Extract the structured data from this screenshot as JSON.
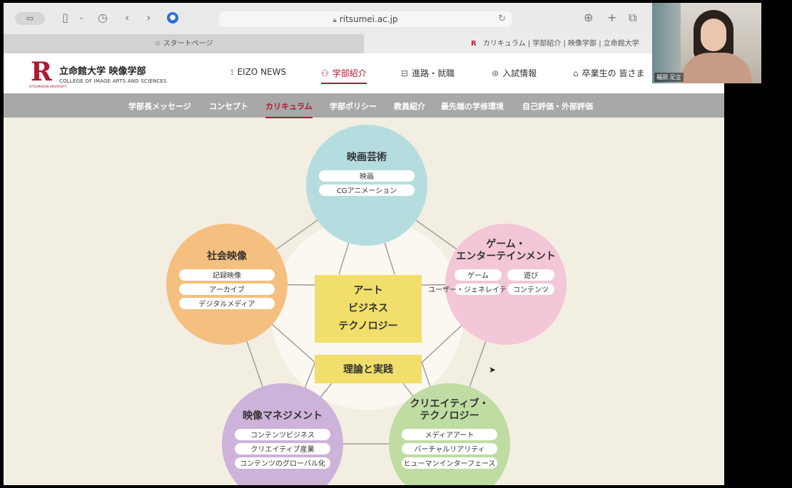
{
  "browser": {
    "sidebar_button": "▭",
    "address": "ritsumei.ac.jp",
    "tabs": [
      {
        "label": "スタートページ"
      },
      {
        "label": "カリキュラム | 学部紹介 | 映像学部 | 立命館大学"
      }
    ]
  },
  "site": {
    "logo_letter": "R",
    "logo_sub": "RITSUMEIKAN UNIVERSITY",
    "brand_ja": "立命館大学 映像学部",
    "brand_en": "COLLEGE OF IMAGE ARTS AND SCIENCES",
    "nav": [
      {
        "label": "EIZO NEWS",
        "icon": "megaphone-icon"
      },
      {
        "label": "学部紹介",
        "icon": "person-icon",
        "active": true
      },
      {
        "label": "進路・就職",
        "icon": "briefcase-icon"
      },
      {
        "label": "入試情報",
        "icon": "medal-icon"
      },
      {
        "label": "卒業生の 皆さま",
        "icon": "mortarboard-icon"
      }
    ],
    "subnav": [
      "学部長メッセージ",
      "コンセプト",
      "カリキュラム",
      "学部ポリシー",
      "教員紹介",
      "最先端の学修環境",
      "自己評価・外部評価"
    ],
    "subnav_active_index": 2
  },
  "diagram": {
    "center_lines": [
      "アート",
      "ビジネス",
      "テクノロジー"
    ],
    "center_sub": "理論と実践",
    "circles": [
      {
        "key": "art",
        "title": [
          "映画芸術"
        ],
        "color": "#b5dde0",
        "tags": [
          [
            "映画"
          ],
          [
            "CGアニメーション"
          ]
        ]
      },
      {
        "key": "game",
        "title": [
          "ゲーム・",
          "エンターテインメント"
        ],
        "color": "#f3c6d8",
        "tags": [
          [
            "ゲーム",
            "遊び"
          ],
          [
            "ユーザー・ジェネレイテッド・",
            "コンテンツ"
          ]
        ]
      },
      {
        "key": "tech",
        "title": [
          "クリエイティブ・",
          "テクノロジー"
        ],
        "color": "#bfdca2",
        "tags": [
          [
            "メディアアート"
          ],
          [
            "バーチャルリアリティ"
          ],
          [
            "ヒューマンインターフェース"
          ]
        ]
      },
      {
        "key": "mgmt",
        "title": [
          "映像マネジメント"
        ],
        "color": "#cdb2d9",
        "tags": [
          [
            "コンテンツビジネス"
          ],
          [
            "クリエイティブ産業"
          ],
          [
            "コンテンツのグローバル化"
          ]
        ]
      },
      {
        "key": "social",
        "title": [
          "社会映像"
        ],
        "color": "#f5bf7f",
        "tags": [
          [
            "記録映像"
          ],
          [
            "アーカイブ"
          ],
          [
            "デジタルメディア"
          ]
        ]
      }
    ],
    "colors": {
      "center_box": "#f2de6a",
      "line": "#9a9a9a",
      "glow": "#fbf8f1"
    }
  },
  "webcam": {
    "name_label": "福田 足立"
  }
}
